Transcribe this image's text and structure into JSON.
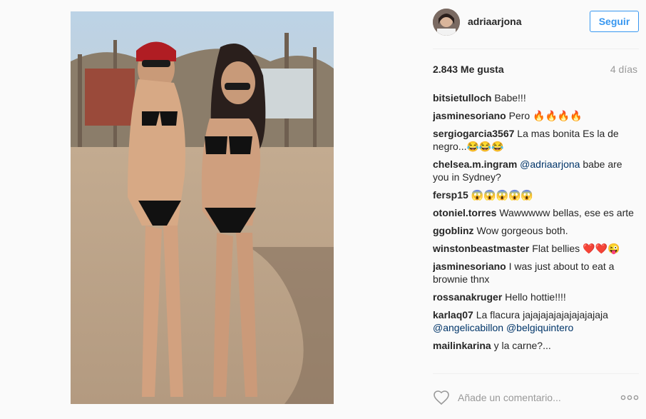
{
  "post": {
    "photo_alt": "Photo"
  },
  "header": {
    "username": "adriaarjona",
    "follow_label": "Seguir"
  },
  "stats": {
    "likes": "2.843 Me gusta",
    "time": "4 días"
  },
  "comments": [
    {
      "user": "bitsietulloch",
      "text": "Babe!!!",
      "emoji": ""
    },
    {
      "user": "jasminesoriano",
      "text": "Pero",
      "emoji": "🔥🔥🔥🔥"
    },
    {
      "user": "sergiogarcia3567",
      "text": "La mas bonita Es la de negro...",
      "emoji": "😂😂😂"
    },
    {
      "user": "chelsea.m.ingram",
      "mention": "@adriaarjona",
      "text": "babe are you in Sydney?"
    },
    {
      "user": "fersp15",
      "text": "",
      "emoji": "😱😱😱😱😱"
    },
    {
      "user": "otoniel.torres",
      "text": "Wawwwww bellas, ese es arte",
      "emoji": ""
    },
    {
      "user": "ggoblinz",
      "text": "Wow gorgeous both.",
      "emoji": ""
    },
    {
      "user": "winstonbeastmaster",
      "text": "Flat bellies",
      "emoji": "❤️❤️😜"
    },
    {
      "user": "jasminesoriano",
      "text": "I was just about to eat a brownie thnx",
      "emoji": ""
    },
    {
      "user": "rossanakruger",
      "text": "Hello hottie!!!!",
      "emoji": ""
    },
    {
      "user": "karlaq07",
      "text": "La flacura jajajajajajajajajajaja",
      "mention1": "@angelicabillon",
      "mention2": "@belgiquintero"
    },
    {
      "user": "mailinkarina",
      "text": "y la carne?...",
      "emoji": ""
    }
  ],
  "footer": {
    "comment_placeholder": "Añade un comentario...",
    "heart_icon": "heart-outline-icon",
    "more_icon": "more-options-icon"
  },
  "colors": {
    "accent": "#3897f0",
    "mention": "#003569",
    "muted": "#999999",
    "text": "#262626",
    "divider": "#efefef"
  }
}
